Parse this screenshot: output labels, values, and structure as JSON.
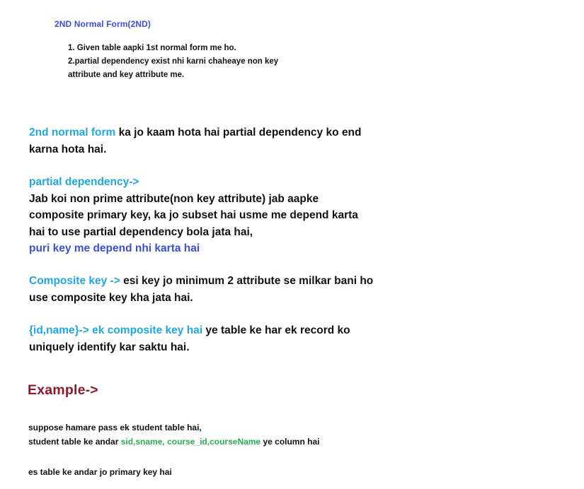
{
  "colors": {
    "text": "#111111",
    "heading_blue": "#3b4fd8",
    "cyan": "#1ea7e0",
    "green": "#25b14b",
    "maroon": "#8b1a2e"
  },
  "heading": "2ND Normal Form(2ND)",
  "intro": {
    "line1": "1. Given table aapki 1st normal form me ho.",
    "line2": "2.partial dependency exist nhi karni chaheaye non key",
    "line3": "attribute and key attribute me."
  },
  "para1": {
    "term": "2nd normal form",
    "rest": " ka jo kaam hota hai partial dependency ko end",
    "line2": "karna hota hai."
  },
  "para2": {
    "term": "partial dependency->",
    "line1": "Jab koi non prime attribute(non key attribute) jab aapke",
    "line2": "composite primary key, ka  jo subset hai usme me depend karta",
    "line3": "hai to use partial dependency bola jata hai,",
    "line4": "puri key me depend nhi karta hai"
  },
  "para3": {
    "term": "Composite key ->",
    "rest": " esi key jo minimum 2 attribute se milkar bani ho",
    "line2": "use composite key kha jata hai."
  },
  "para4": {
    "term": "{id,name}-> ek composite key hai",
    "rest": " ye table ke har ek record ko",
    "line2": "uniquely identify kar saktu hai."
  },
  "example_heading": "Example->",
  "example": {
    "line1": "suppose hamare pass ek student table hai,",
    "line2_pre": "student table ke andar ",
    "line2_cols": "sid,sname, course_id,courseName",
    "line2_post": " ye column hai",
    "line3": "es table ke andar jo primary key hai"
  }
}
